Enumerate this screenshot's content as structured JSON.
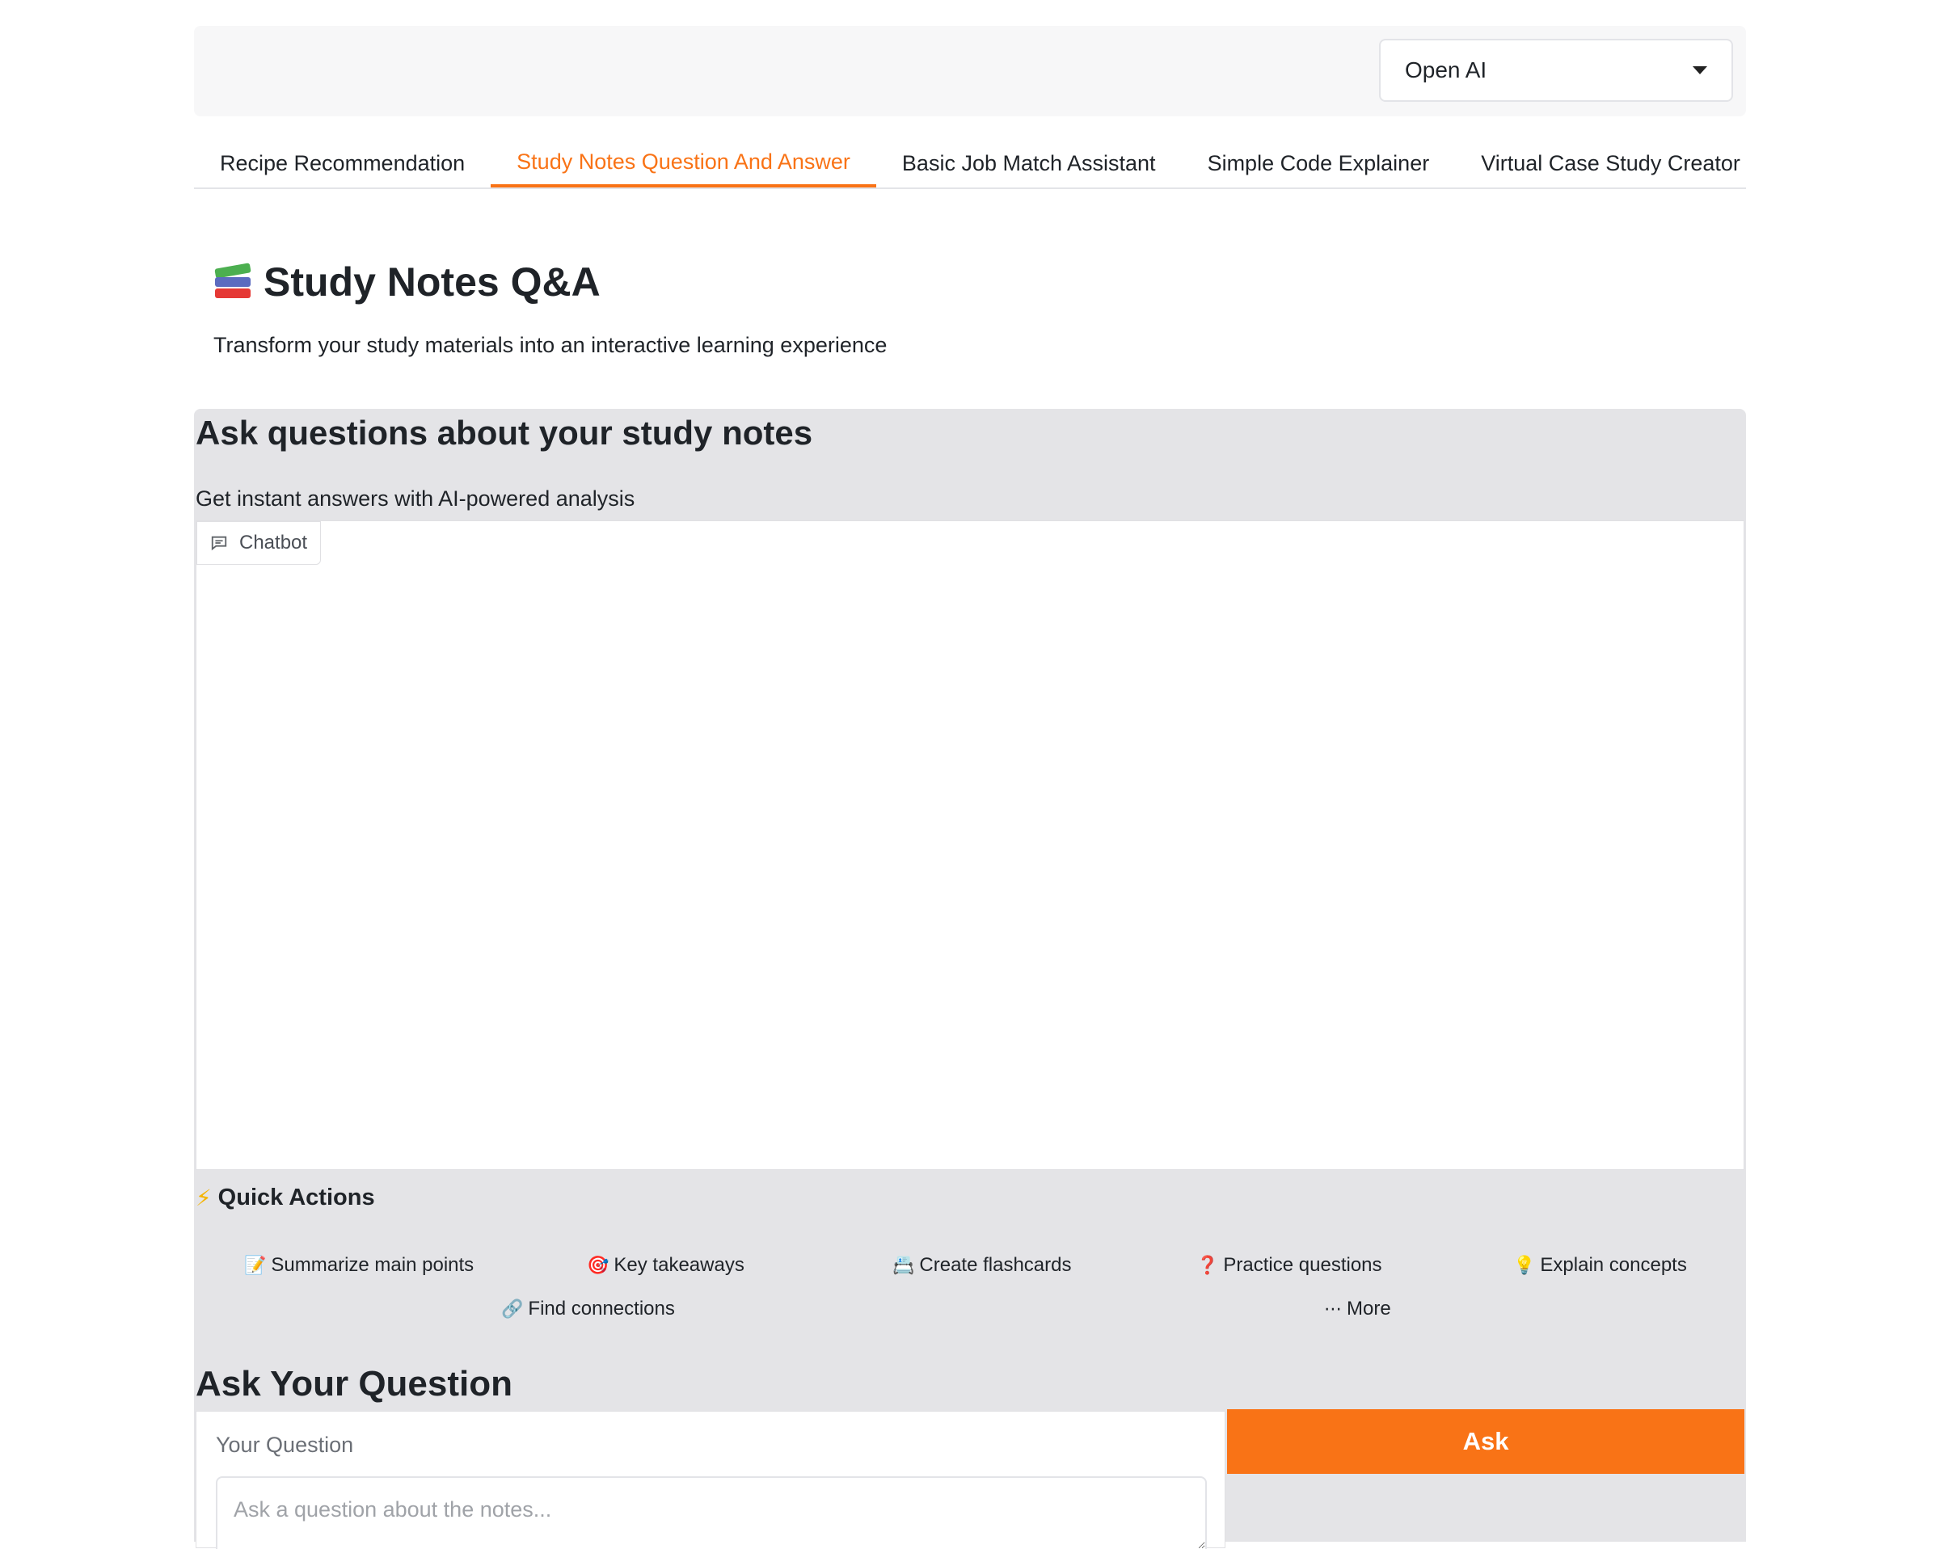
{
  "model_selector": {
    "value": "Open AI"
  },
  "tabs": [
    {
      "label": "Recipe Recommendation"
    },
    {
      "label": "Study Notes Question And Answer"
    },
    {
      "label": "Basic Job Match Assistant"
    },
    {
      "label": "Simple Code Explainer"
    },
    {
      "label": "Virtual Case Study Creator"
    }
  ],
  "active_tab": 1,
  "page": {
    "title": "Study Notes Q&A",
    "subtitle": "Transform your study materials into an interactive learning experience"
  },
  "qa_section": {
    "heading": "Ask questions about your study notes",
    "description": "Get instant answers with AI-powered analysis",
    "chatbot_label": "Chatbot"
  },
  "quick_actions": {
    "title": "Quick Actions",
    "items": [
      {
        "emoji": "📝",
        "label": "Summarize main points"
      },
      {
        "emoji": "🎯",
        "label": "Key takeaways"
      },
      {
        "emoji": "📇",
        "label": "Create flashcards"
      },
      {
        "emoji": "❓",
        "label": "Practice questions"
      },
      {
        "emoji": "💡",
        "label": "Explain concepts"
      },
      {
        "emoji": "🔗",
        "label": "Find connections"
      },
      {
        "emoji": "⋯",
        "label": "More"
      }
    ]
  },
  "ask_section": {
    "heading": "Ask Your Question",
    "input_label": "Your Question",
    "input_placeholder": "Ask a question about the notes...",
    "button_label": "Ask"
  },
  "colors": {
    "accent": "#f97316",
    "panel_bg": "#e4e4e7"
  }
}
